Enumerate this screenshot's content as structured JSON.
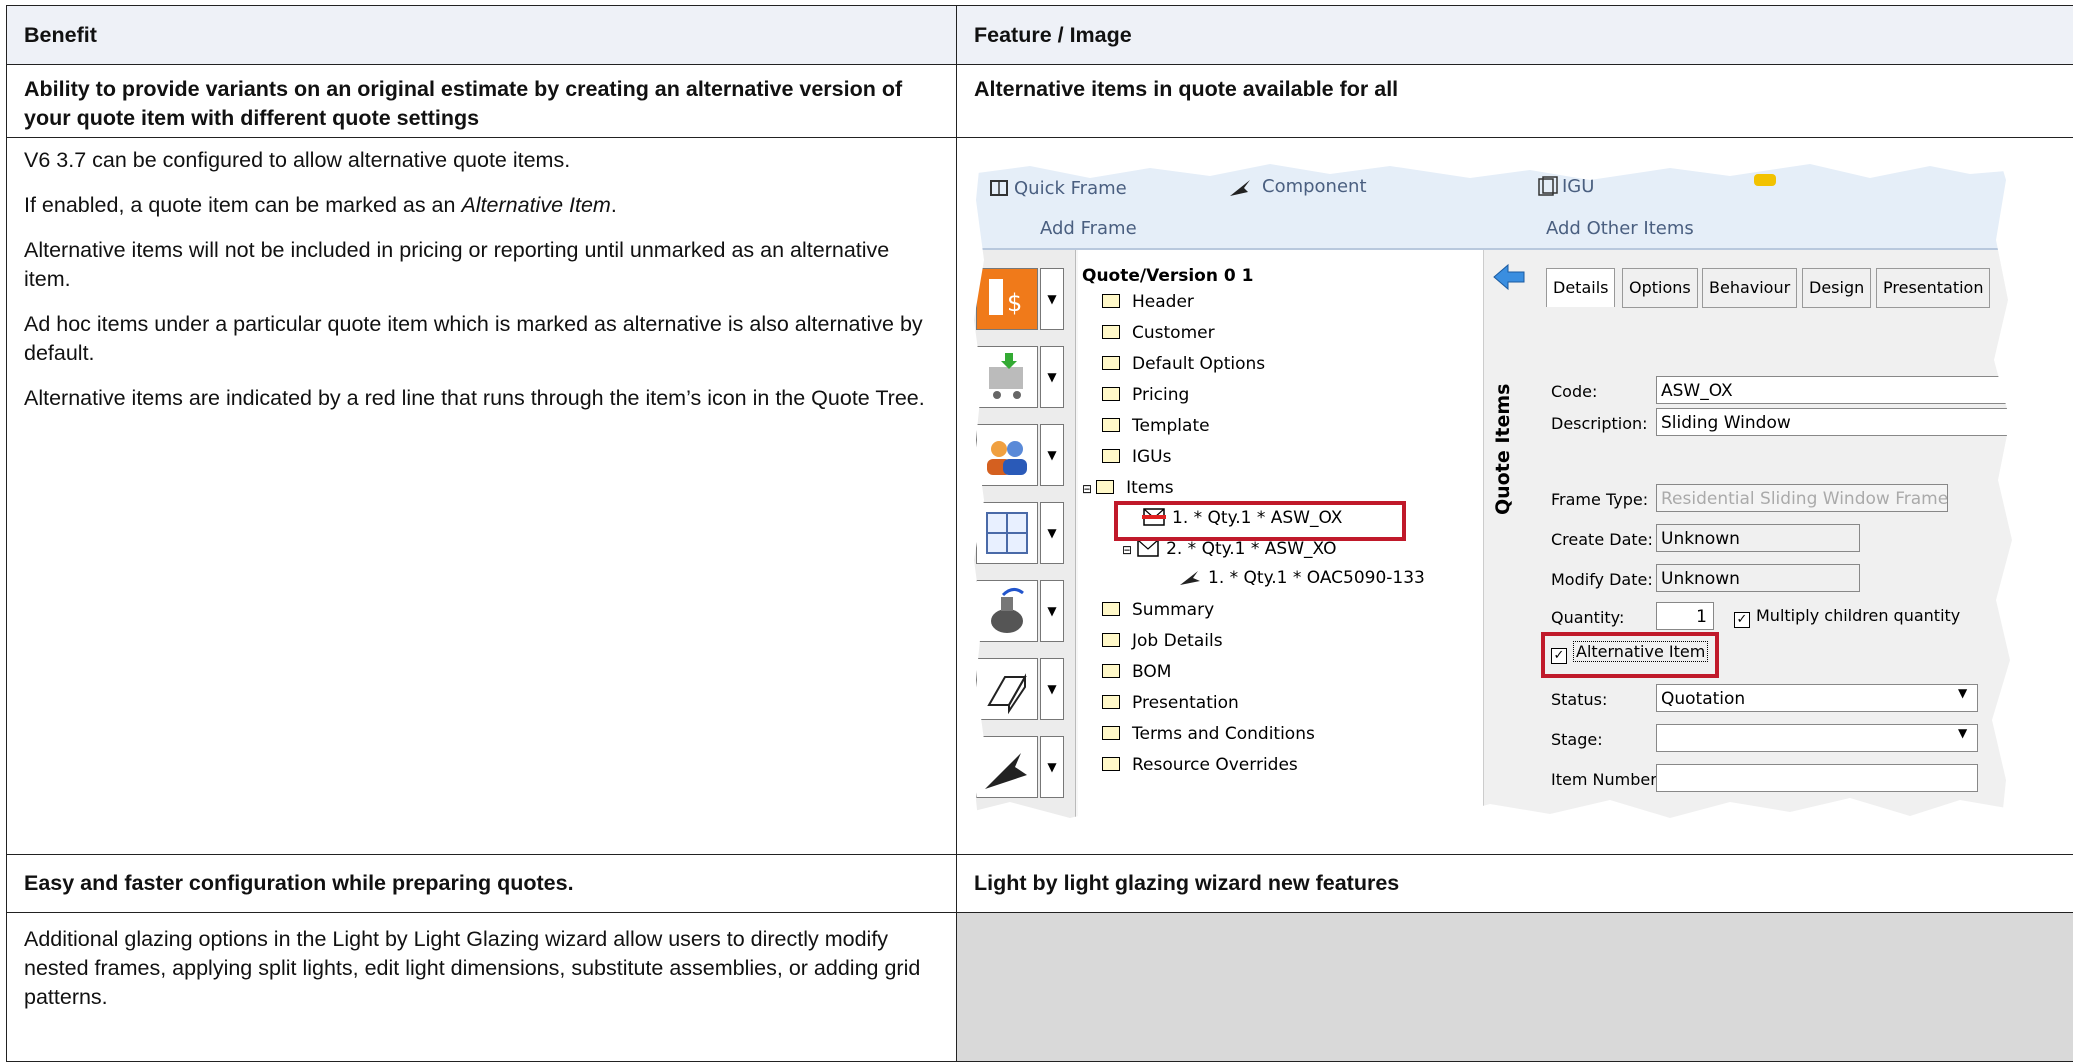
{
  "table": {
    "headers": [
      "Benefit",
      "Feature / Image"
    ],
    "rows": [
      {
        "benefit": "Ability to provide variants on an original estimate by creating an alternative version of your quote item with different quote settings",
        "feature": "Alternative items in quote available for all"
      },
      {
        "paragraphs": [
          "V6 3.7 can be configured to allow alternative quote items.",
          "If enabled, a quote item can be marked as an ",
          "Alternative Item",
          ".",
          "Alternative items will not be included in pricing or reporting until unmarked as an alternative item.",
          "Ad hoc items under a particular quote item which is marked as alternative is also alternative by default.",
          "Alternative items are indicated by a red line that runs through the item’s icon in the Quote Tree."
        ]
      },
      {
        "benefit": "Easy and faster configuration while preparing quotes.",
        "feature": "Light by light glazing wizard new features"
      },
      {
        "benefit": "Additional glazing options in the Light by Light Glazing wizard allow users to directly modify nested frames, applying split lights, edit light dimensions, substitute assemblies, or adding grid patterns."
      }
    ]
  },
  "screenshot": {
    "ribbon": {
      "quick_frame": "Quick Frame",
      "component": "Component",
      "igu": "IGU",
      "add_frame": "Add Frame",
      "add_other_items": "Add Other Items"
    },
    "tree": {
      "root": "Quote/Version 0 1",
      "nodes": [
        "Header",
        "Customer",
        "Default Options",
        "Pricing",
        "Template",
        "IGUs",
        "Items"
      ],
      "item1": "1.  *  Qty.1  *  ASW_OX",
      "item2": "2.  *  Qty.1  *  ASW_XO",
      "subitem": "1.  *  Qty.1  *  OAC5090-133",
      "nodes_after": [
        "Summary",
        "Job Details",
        "BOM",
        "Presentation",
        "Terms and Conditions",
        "Resource Overrides"
      ]
    },
    "vertical_label": "Quote Items",
    "tabs": [
      "Details",
      "Options",
      "Behaviour",
      "Design",
      "Presentation"
    ],
    "fields": {
      "code_label": "Code:",
      "code_value": "ASW_OX",
      "desc_label": "Description:",
      "desc_value": "Sliding Window",
      "frame_type_label": "Frame Type:",
      "frame_type_value": "Residential Sliding Window Frame",
      "create_date_label": "Create Date:",
      "create_date_value": "Unknown",
      "modify_date_label": "Modify Date:",
      "modify_date_value": "Unknown",
      "quantity_label": "Quantity:",
      "quantity_value": "1",
      "multiply_label": "Multiply children quantity",
      "alt_item_label": "Alternative Item",
      "status_label": "Status:",
      "status_value": "Quotation",
      "stage_label": "Stage:",
      "stage_value": "",
      "item_number_label": "Item Number:"
    }
  }
}
